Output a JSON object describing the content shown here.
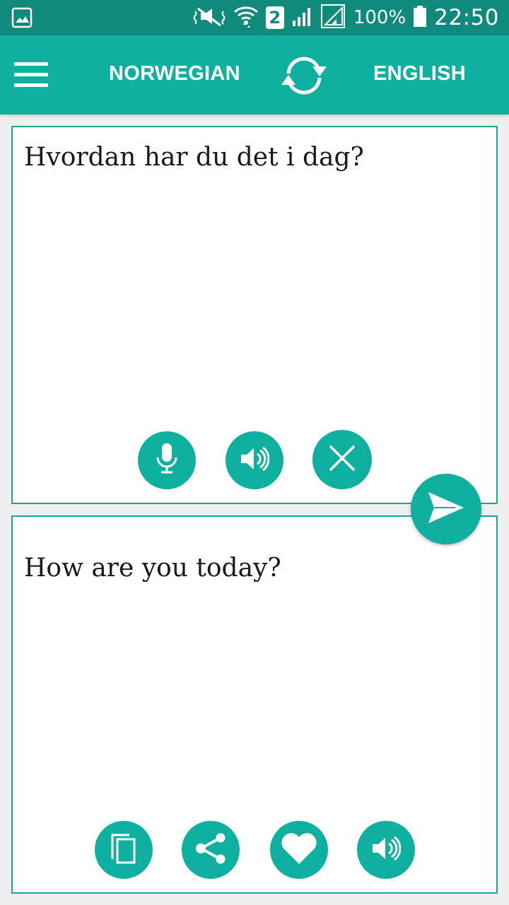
{
  "status_bar": {
    "battery_percent": "100%",
    "sim_slot": "2",
    "time": "22:50"
  },
  "toolbar": {
    "source_language": "NORWEGIAN",
    "target_language": "ENGLISH"
  },
  "source_card": {
    "text": "Hvordan har du det i dag?"
  },
  "target_card": {
    "text": "How are you today?"
  },
  "colors": {
    "primary": "#0fb09f",
    "status_bar": "#0f8a7c",
    "border": "#15a796",
    "background": "#efefef"
  },
  "icons": {
    "menu": "hamburger-menu-icon",
    "swap": "swap-languages-icon",
    "mic": "microphone-icon",
    "speak": "speaker-icon",
    "clear": "close-icon",
    "send": "send-icon",
    "copy": "copy-icon",
    "share": "share-icon",
    "favorite": "heart-icon"
  }
}
